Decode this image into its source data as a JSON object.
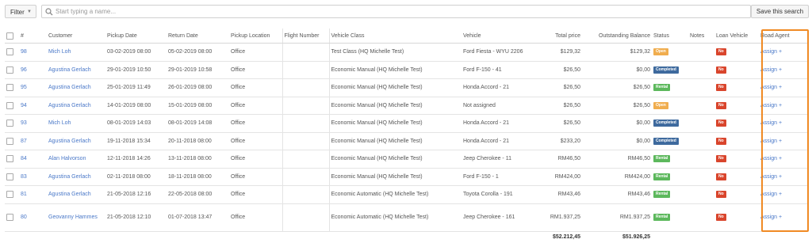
{
  "toolbar": {
    "filter_label": "Filter",
    "search_placeholder": "Start typing a name...",
    "save_label": "Save this search"
  },
  "columns": [
    "#",
    "Customer",
    "Pickup Date",
    "Return Date",
    "Pickup Location",
    "Flight Number",
    "Vehicle Class",
    "Vehicle",
    "Total price",
    "Outstanding Balance",
    "Status",
    "Notes",
    "Loan Vehicle",
    "Road Agent"
  ],
  "rows": [
    {
      "id": "98",
      "customer": "Mich Loh",
      "pickup": "03-02-2019 08:00",
      "ret": "05-02-2019 08:00",
      "location": "Office",
      "flight": "",
      "vclass": "Test Class (HQ Michelle Test)",
      "vehicle": "Ford Fiesta - WYU 2206",
      "total": "$129,32",
      "balance": "$129,32",
      "status": "Open",
      "status_kind": "open",
      "loan": "No",
      "agent": "Assign +"
    },
    {
      "id": "96",
      "customer": "Agustina Gerlach",
      "pickup": "29-01-2019 10:50",
      "ret": "29-01-2019 10:58",
      "location": "Office",
      "flight": "",
      "vclass": "Economic Manual (HQ Michelle Test)",
      "vehicle": "Ford F-150 - 41",
      "total": "$26,50",
      "balance": "$0,00",
      "status": "Completed",
      "status_kind": "completed",
      "loan": "No",
      "agent": "Assign +"
    },
    {
      "id": "95",
      "customer": "Agustina Gerlach",
      "pickup": "25-01-2019 11:49",
      "ret": "26-01-2019 08:00",
      "location": "Office",
      "flight": "",
      "vclass": "Economic Manual (HQ Michelle Test)",
      "vehicle": "Honda Accord - 21",
      "total": "$26,50",
      "balance": "$26,50",
      "status": "Rental",
      "status_kind": "rental",
      "loan": "No",
      "agent": "Assign +"
    },
    {
      "id": "94",
      "customer": "Agustina Gerlach",
      "pickup": "14-01-2019 08:00",
      "ret": "15-01-2019 08:00",
      "location": "Office",
      "flight": "",
      "vclass": "Economic Manual (HQ Michelle Test)",
      "vehicle": "Not assigned",
      "total": "$26,50",
      "balance": "$26,50",
      "status": "Open",
      "status_kind": "open",
      "loan": "No",
      "agent": "Assign +"
    },
    {
      "id": "93",
      "customer": "Mich Loh",
      "pickup": "08-01-2019 14:03",
      "ret": "08-01-2019 14:08",
      "location": "Office",
      "flight": "",
      "vclass": "Economic Manual (HQ Michelle Test)",
      "vehicle": "Honda Accord - 21",
      "total": "$26,50",
      "balance": "$0,00",
      "status": "Completed",
      "status_kind": "completed",
      "loan": "No",
      "agent": "Assign +"
    },
    {
      "id": "87",
      "customer": "Agustina Gerlach",
      "pickup": "19-11-2018 15:34",
      "ret": "20-11-2018 08:00",
      "location": "Office",
      "flight": "",
      "vclass": "Economic Manual (HQ Michelle Test)",
      "vehicle": "Honda Accord - 21",
      "total": "$233,20",
      "balance": "$0,00",
      "status": "Completed",
      "status_kind": "completed",
      "loan": "No",
      "agent": "Assign +"
    },
    {
      "id": "84",
      "customer": "Alan Halvorson",
      "pickup": "12-11-2018 14:26",
      "ret": "13-11-2018 08:00",
      "location": "Office",
      "flight": "",
      "vclass": "Economic Manual (HQ Michelle Test)",
      "vehicle": "Jeep Cherokee - 11",
      "total": "RM46,50",
      "balance": "RM46,50",
      "status": "Rental",
      "status_kind": "rental",
      "loan": "No",
      "agent": "Assign +"
    },
    {
      "id": "83",
      "customer": "Agustina Gerlach",
      "pickup": "02-11-2018 08:00",
      "ret": "18-11-2018 08:00",
      "location": "Office",
      "flight": "",
      "vclass": "Economic Manual (HQ Michelle Test)",
      "vehicle": "Ford F-150 - 1",
      "total": "RM424,00",
      "balance": "RM424,00",
      "status": "Rental",
      "status_kind": "rental",
      "loan": "No",
      "agent": "Assign +"
    },
    {
      "id": "81",
      "customer": "Agustina Gerlach",
      "pickup": "21-05-2018 12:16",
      "ret": "22-05-2018 08:00",
      "location": "Office",
      "flight": "",
      "vclass": "Economic Automatic (HQ Michelle Test)",
      "vehicle": "Toyota Corolla - 191",
      "total": "RM43,46",
      "balance": "RM43,46",
      "status": "Rental",
      "status_kind": "rental",
      "loan": "No",
      "agent": "Assign +"
    },
    {
      "id": "80",
      "customer": "Geovanny Hammes",
      "pickup": "21-05-2018 12:10",
      "ret": "01-07-2018 13:47",
      "location": "Office",
      "flight": "",
      "vclass": "Economic Automatic (HQ Michelle Test)",
      "vehicle": "Jeep Cherokee - 161",
      "total": "RM1.937,25",
      "balance": "RM1.937,25",
      "status": "Rental",
      "status_kind": "rental",
      "loan": "No",
      "agent": "Assign +"
    }
  ],
  "totals": {
    "total": "$52.212,45",
    "balance": "$51.926,25"
  }
}
